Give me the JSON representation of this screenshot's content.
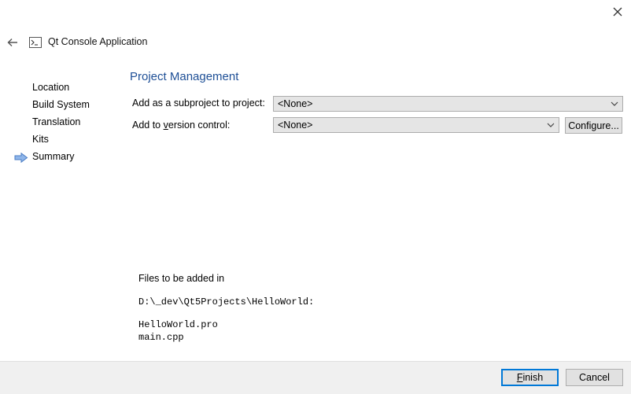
{
  "window": {
    "title": "Qt Console Application",
    "close_icon": "close-icon",
    "back_icon": "back-arrow-icon",
    "title_icon": "console-app-icon"
  },
  "steps": [
    {
      "label": "Location"
    },
    {
      "label": "Build System"
    },
    {
      "label": "Translation"
    },
    {
      "label": "Kits"
    },
    {
      "label": "Summary",
      "current": true
    }
  ],
  "page": {
    "heading": "Project Management",
    "subproject_label": "Add as a subproject to project:",
    "subproject_value": "<None>",
    "vc_label_pre": "Add to ",
    "vc_label_accel": "v",
    "vc_label_post": "ersion control:",
    "vc_value": "<None>",
    "configure_label": "Configure..."
  },
  "files": {
    "title": "Files to be added in",
    "path": "D:\\_dev\\Qt5Projects\\HelloWorld:",
    "list": [
      "HelloWorld.pro",
      "main.cpp"
    ]
  },
  "footer": {
    "finish_accel": "F",
    "finish_rest": "inish",
    "cancel_label": "Cancel"
  },
  "colors": {
    "heading": "#1e4f96",
    "step_arrow": "#5b8fd6",
    "primary_border": "#0078d7"
  }
}
